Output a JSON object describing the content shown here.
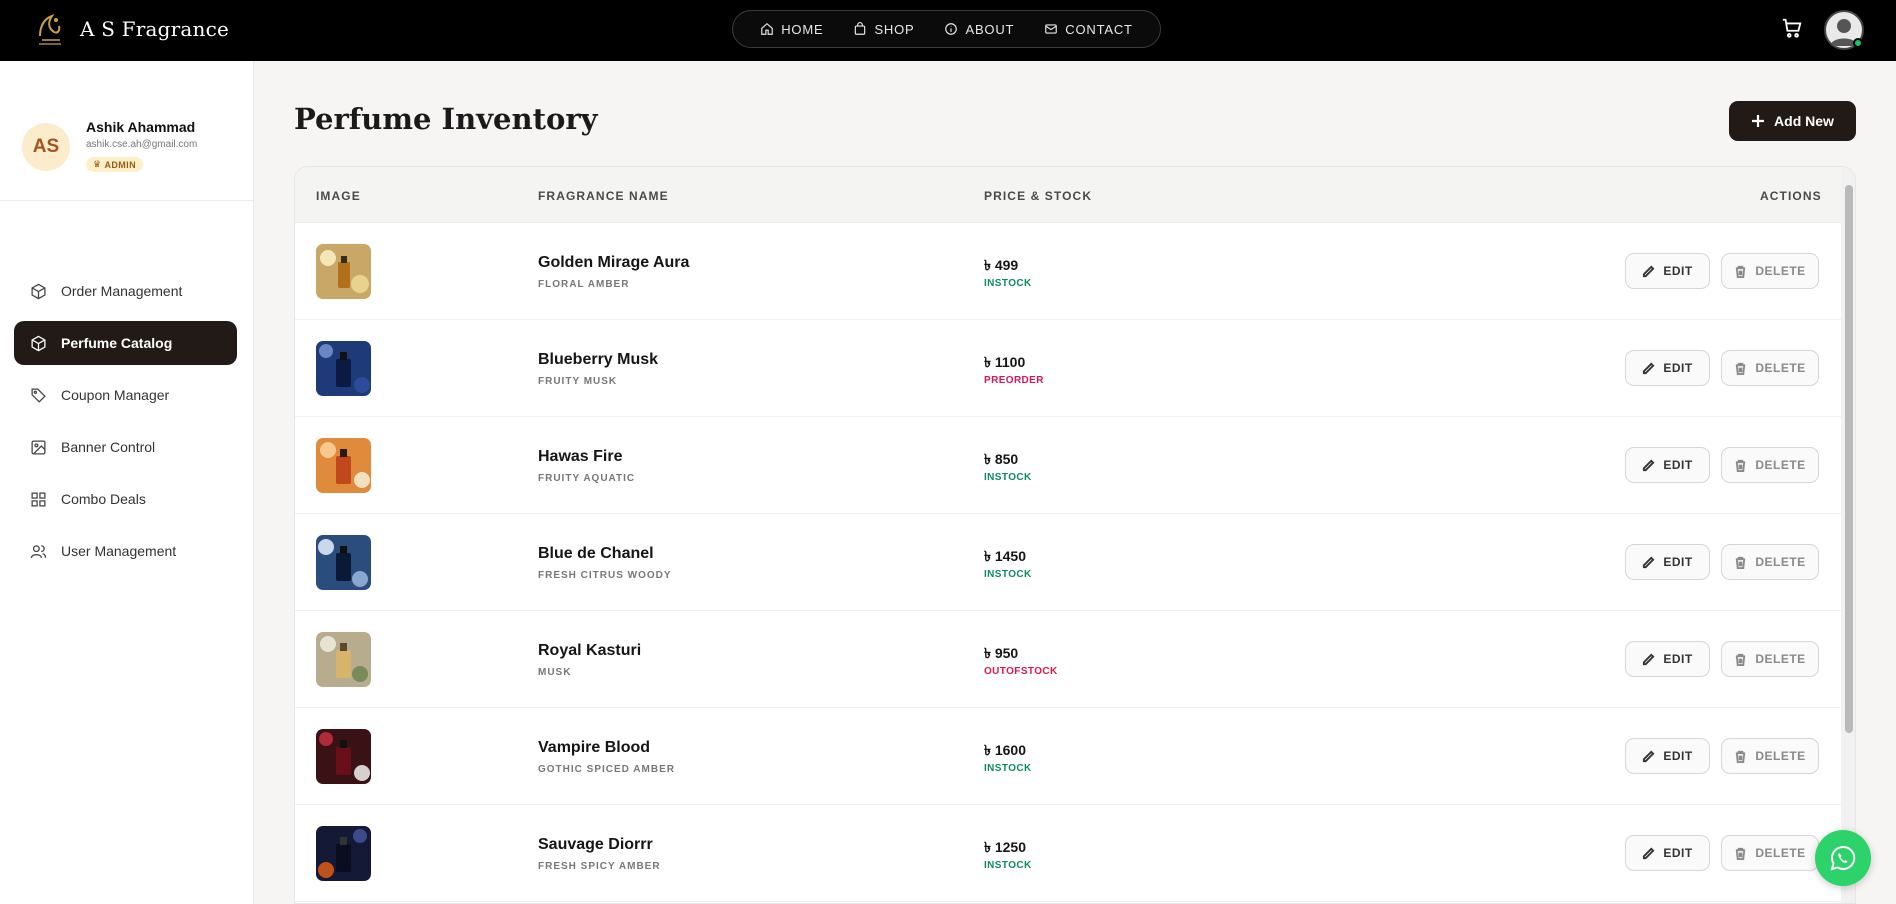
{
  "brand": {
    "name": "A S Fragrance"
  },
  "nav": {
    "links": [
      {
        "label": "HOME",
        "icon": "home-icon"
      },
      {
        "label": "SHOP",
        "icon": "bag-icon"
      },
      {
        "label": "ABOUT",
        "icon": "info-icon"
      },
      {
        "label": "CONTACT",
        "icon": "mail-icon"
      }
    ]
  },
  "profile": {
    "initials": "AS",
    "name": "Ashik Ahammad",
    "email": "ashik.cse.ah@gmail.com",
    "role": "ADMIN"
  },
  "sidebar": {
    "items": [
      {
        "label": "Order Management",
        "icon": "box-icon",
        "active": false
      },
      {
        "label": "Perfume Catalog",
        "icon": "box-icon",
        "active": true
      },
      {
        "label": "Coupon Manager",
        "icon": "tag-icon",
        "active": false
      },
      {
        "label": "Banner Control",
        "icon": "image-icon",
        "active": false
      },
      {
        "label": "Combo Deals",
        "icon": "grid-icon",
        "active": false
      },
      {
        "label": "User Management",
        "icon": "users-icon",
        "active": false
      }
    ]
  },
  "main": {
    "title": "Perfume Inventory",
    "add_label": "Add New"
  },
  "table": {
    "headers": {
      "image": "IMAGE",
      "name": "FRAGRANCE NAME",
      "price": "PRICE & STOCK",
      "actions": "ACTIONS"
    },
    "edit_label": "EDIT",
    "delete_label": "DELETE",
    "rows": [
      {
        "name": "Golden Mirage Aura",
        "family": "FLORAL AMBER",
        "price": "৳ 499",
        "stock": "INSTOCK"
      },
      {
        "name": "Blueberry Musk",
        "family": "FRUITY MUSK",
        "price": "৳ 1100",
        "stock": "PREORDER"
      },
      {
        "name": "Hawas Fire",
        "family": "FRUITY AQUATIC",
        "price": "৳ 850",
        "stock": "INSTOCK"
      },
      {
        "name": "Blue de Chanel",
        "family": "FRESH CITRUS WOODY",
        "price": "৳ 1450",
        "stock": "INSTOCK"
      },
      {
        "name": "Royal Kasturi",
        "family": "MUSK",
        "price": "৳ 950",
        "stock": "OUTOFSTOCK"
      },
      {
        "name": "Vampire Blood",
        "family": "GOTHIC SPICED AMBER",
        "price": "৳ 1600",
        "stock": "INSTOCK"
      },
      {
        "name": "Sauvage Diorrr",
        "family": "FRESH SPICY AMBER",
        "price": "৳ 1250",
        "stock": "INSTOCK"
      }
    ]
  },
  "colors": {
    "instock": "#0f8a5f",
    "preorder": "#d8155b",
    "outofstock": "#e01848",
    "accent_dark": "#221a17"
  }
}
